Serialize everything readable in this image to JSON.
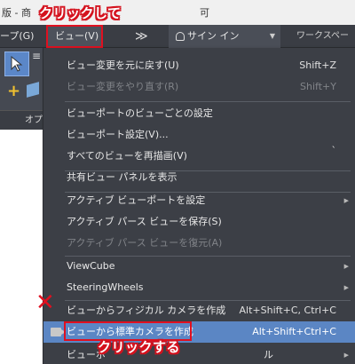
{
  "window": {
    "title_fragment": "版 - 商",
    "title_tail": "可"
  },
  "annotations": {
    "top": "クリックして",
    "bottom": "クリックする",
    "x_mark": "✕"
  },
  "menubar": {
    "group": "ープ(G)",
    "view": "ビュー(V)",
    "chevron": "≫",
    "signin": "サイン イン",
    "workspace": "ワークスペー"
  },
  "toolbar": {
    "bottom_label": "オプ"
  },
  "menu": {
    "undo_view": {
      "label": "ビュー変更を元に戻す(U)",
      "shortcut": "Shift+Z"
    },
    "redo_view": {
      "label": "ビュー変更をやり直す(R)",
      "shortcut": "Shift+Y"
    },
    "per_view_settings": {
      "label": "ビューポートのビューごとの設定"
    },
    "viewport_settings": {
      "label": "ビューポート設定(V)..."
    },
    "redraw_all": {
      "label": "すべてのビューを再描画(V)",
      "shortcut": "`"
    },
    "shared_panel": {
      "label": "共有ビュー パネルを表示"
    },
    "set_active_viewport": {
      "label": "アクティブ ビューポートを設定"
    },
    "save_active_perspective": {
      "label": "アクティブ パース ビューを保存(S)"
    },
    "restore_active_perspective": {
      "label": "アクティブ パース ビューを復元(A)"
    },
    "viewcube": {
      "label": "ViewCube"
    },
    "steeringwheels": {
      "label": "SteeringWheels"
    },
    "create_physical_camera": {
      "label": "ビューからフィジカル カメラを作成",
      "shortcut": "Alt+Shift+C, Ctrl+C"
    },
    "create_standard_camera": {
      "label": "ビューから標準カメラを作成",
      "shortcut": "Alt+Shift+Ctrl+C"
    },
    "last_item": {
      "label": "ビューポ",
      "tail": "ル"
    }
  },
  "colors": {
    "accent_red": "#e01020",
    "menu_bg": "#3c3f46",
    "highlight": "#5b86c4"
  }
}
